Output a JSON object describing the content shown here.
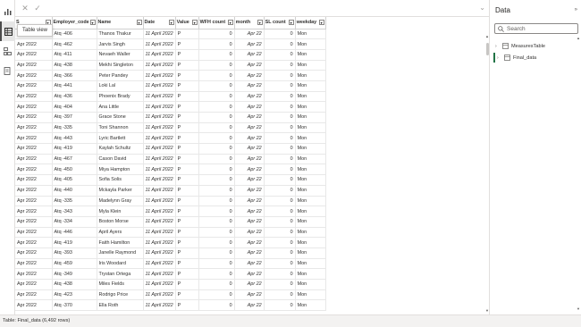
{
  "left_rail": {
    "items": [
      {
        "name": "report-view",
        "icon": "bar-chart-icon"
      },
      {
        "name": "table-view",
        "icon": "table-grid-icon"
      },
      {
        "name": "model-view",
        "icon": "model-diagram-icon"
      },
      {
        "name": "dax-view",
        "icon": "dax-query-icon"
      }
    ]
  },
  "tooltip": "Table view",
  "table": {
    "columns": [
      "S",
      "Employer_code",
      "Name",
      "Date",
      "Value",
      "WFH count",
      "month",
      "SL count",
      "weekday"
    ],
    "rows": [
      [
        "Apr 2022",
        "Atq -406",
        "Thanos Thakur",
        "11 April 2022",
        "P",
        "0",
        "Apr 22",
        "0",
        "Mon"
      ],
      [
        "Apr 2022",
        "Atq -462",
        "Jarvis Singh",
        "11 April 2022",
        "P",
        "0",
        "Apr 22",
        "0",
        "Mon"
      ],
      [
        "Apr 2022",
        "Atq -411",
        "Nevaeh Waller",
        "11 April 2022",
        "P",
        "0",
        "Apr 22",
        "0",
        "Mon"
      ],
      [
        "Apr 2022",
        "Atq -438",
        "Mekhi Singleton",
        "11 April 2022",
        "P",
        "0",
        "Apr 22",
        "0",
        "Mon"
      ],
      [
        "Apr 2022",
        "Atq -366",
        "Peter Pandey",
        "11 April 2022",
        "P",
        "0",
        "Apr 22",
        "0",
        "Mon"
      ],
      [
        "Apr 2022",
        "Atq -441",
        "Loki Lal",
        "11 April 2022",
        "P",
        "0",
        "Apr 22",
        "0",
        "Mon"
      ],
      [
        "Apr 2022",
        "Atq -436",
        "Phoenix Brady",
        "11 April 2022",
        "P",
        "0",
        "Apr 22",
        "0",
        "Mon"
      ],
      [
        "Apr 2022",
        "Atq -404",
        "Ana Little",
        "11 April 2022",
        "P",
        "0",
        "Apr 22",
        "0",
        "Mon"
      ],
      [
        "Apr 2022",
        "Atq -397",
        "Grace Stone",
        "11 April 2022",
        "P",
        "0",
        "Apr 22",
        "0",
        "Mon"
      ],
      [
        "Apr 2022",
        "Atq -335",
        "Toni Shannon",
        "11 April 2022",
        "P",
        "0",
        "Apr 22",
        "0",
        "Mon"
      ],
      [
        "Apr 2022",
        "Atq -443",
        "Lyric Bartlett",
        "11 April 2022",
        "P",
        "0",
        "Apr 22",
        "0",
        "Mon"
      ],
      [
        "Apr 2022",
        "Atq -419",
        "Kaylah Schultz",
        "11 April 2022",
        "P",
        "0",
        "Apr 22",
        "0",
        "Mon"
      ],
      [
        "Apr 2022",
        "Atq -467",
        "Cason David",
        "11 April 2022",
        "P",
        "0",
        "Apr 22",
        "0",
        "Mon"
      ],
      [
        "Apr 2022",
        "Atq -450",
        "Miya Hampton",
        "11 April 2022",
        "P",
        "0",
        "Apr 22",
        "0",
        "Mon"
      ],
      [
        "Apr 2022",
        "Atq -405",
        "Sofia Solis",
        "11 April 2022",
        "P",
        "0",
        "Apr 22",
        "0",
        "Mon"
      ],
      [
        "Apr 2022",
        "Atq -440",
        "Mckayla Parker",
        "11 April 2022",
        "P",
        "0",
        "Apr 22",
        "0",
        "Mon"
      ],
      [
        "Apr 2022",
        "Atq -335",
        "Madelynn Gray",
        "11 April 2022",
        "P",
        "0",
        "Apr 22",
        "0",
        "Mon"
      ],
      [
        "Apr 2022",
        "Atq -343",
        "Myla Klein",
        "11 April 2022",
        "P",
        "0",
        "Apr 22",
        "0",
        "Mon"
      ],
      [
        "Apr 2022",
        "Atq -334",
        "Boston Morse",
        "11 April 2022",
        "P",
        "0",
        "Apr 22",
        "0",
        "Mon"
      ],
      [
        "Apr 2022",
        "Atq -446",
        "April Ayers",
        "11 April 2022",
        "P",
        "0",
        "Apr 22",
        "0",
        "Mon"
      ],
      [
        "Apr 2022",
        "Atq -419",
        "Faith Hamilton",
        "11 April 2022",
        "P",
        "0",
        "Apr 22",
        "0",
        "Mon"
      ],
      [
        "Apr 2022",
        "Atq -393",
        "Janelle Raymond",
        "11 April 2022",
        "P",
        "0",
        "Apr 22",
        "0",
        "Mon"
      ],
      [
        "Apr 2022",
        "Atq -459",
        "Iris Woodard",
        "11 April 2022",
        "P",
        "0",
        "Apr 22",
        "0",
        "Mon"
      ],
      [
        "Apr 2022",
        "Atq -349",
        "Trystan Ortega",
        "11 April 2022",
        "P",
        "0",
        "Apr 22",
        "0",
        "Mon"
      ],
      [
        "Apr 2022",
        "Atq -438",
        "Miles Fields",
        "11 April 2022",
        "P",
        "0",
        "Apr 22",
        "0",
        "Mon"
      ],
      [
        "Apr 2022",
        "Atq -423",
        "Rodrigo Price",
        "11 April 2022",
        "P",
        "0",
        "Apr 22",
        "0",
        "Mon"
      ],
      [
        "Apr 2022",
        "Atq -370",
        "Ella Roth",
        "11 April 2022",
        "P",
        "0",
        "Apr 22",
        "0",
        "Mon"
      ]
    ]
  },
  "data_panel": {
    "title": "Data",
    "search_placeholder": "Search",
    "tables": [
      "MeasuresTable",
      "Final_data"
    ]
  },
  "status_text": "Table: Final_data (6,492 rows)",
  "colors": {
    "accent": "#217346",
    "header_border": "#d0d0d0"
  }
}
